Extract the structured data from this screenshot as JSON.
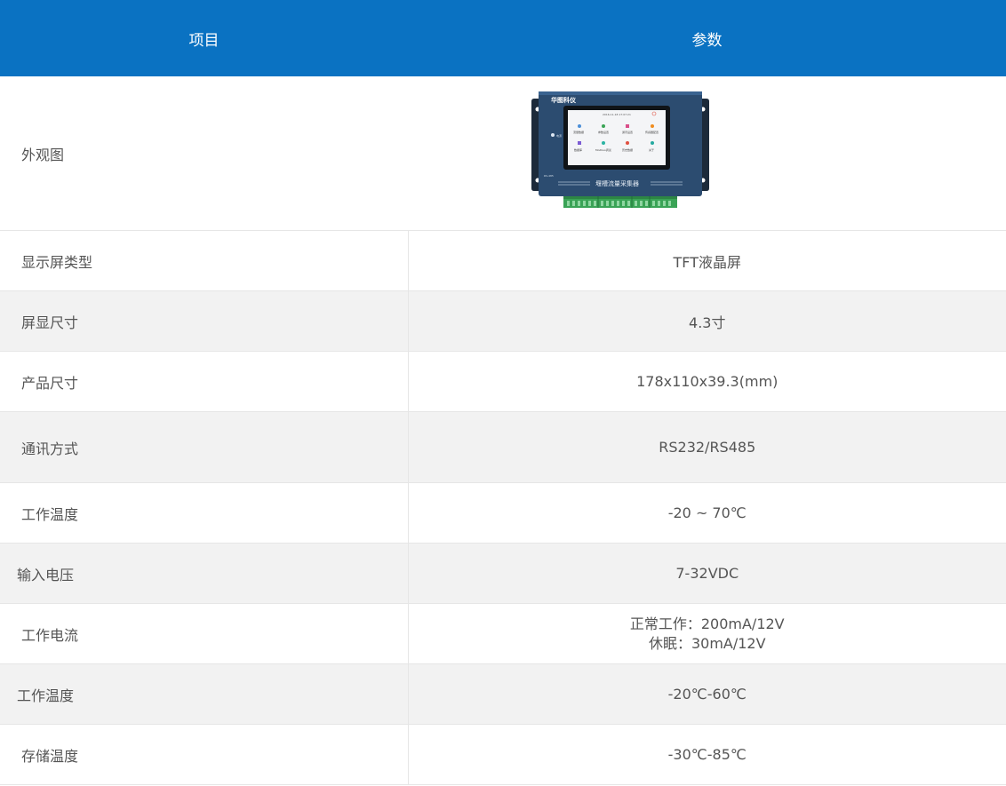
{
  "table": {
    "header": {
      "item": "项目",
      "param": "参数"
    },
    "rows": [
      {
        "item": "外观图",
        "value": ""
      },
      {
        "item": "显示屏类型",
        "value": "TFT液晶屏"
      },
      {
        "item": "屏显尺寸",
        "value": "4.3寸"
      },
      {
        "item": "产品尺寸",
        "value": "178x110x39.3(mm)"
      },
      {
        "item": "通讯方式",
        "value": "RS232/RS485"
      },
      {
        "item": "工作温度",
        "value": "-20 ~ 70℃"
      },
      {
        "item": "输入电压",
        "value": "7-32VDC"
      },
      {
        "item": "工作电流",
        "value_line1": "正常工作：200mA/12V",
        "value_line2": "休眠：30mA/12V"
      },
      {
        "item": "工作温度",
        "value": "-20℃-60℃"
      },
      {
        "item": "存储温度",
        "value": "-30℃-85℃"
      }
    ]
  },
  "device_image": {
    "brand": "华图科仪",
    "label": "堰槽流量采集器",
    "screen_date": "2016-11-18 17:07:21",
    "menu": [
      "流量数据",
      "参数设置",
      "通讯设置",
      "传感器配置",
      "数据库",
      "Modbus调试",
      "历史数据",
      "关于"
    ],
    "led_label": "电源",
    "port_label": "RS-485",
    "colors": {
      "body": "#2c4c70",
      "terminal": "#3aa356",
      "header": "#0a72c2"
    }
  }
}
